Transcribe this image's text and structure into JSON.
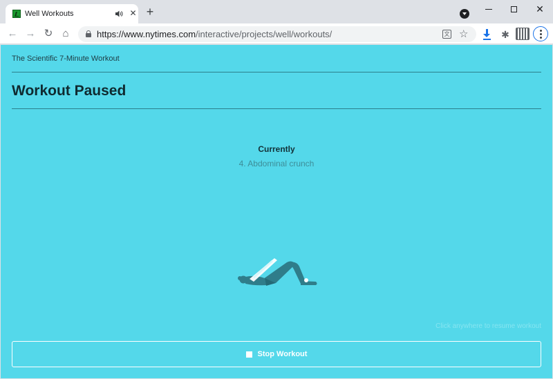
{
  "browser": {
    "tab": {
      "title": "Well Workouts"
    },
    "url": {
      "host": "https://www.nytimes.com",
      "path": "/interactive/projects/well/workouts/"
    },
    "icons": {
      "newtab": "+",
      "close": "✕",
      "window_close": "✕",
      "back": "←",
      "forward": "→",
      "reload": "↻",
      "home": "⌂",
      "star": "☆",
      "puzzle": "✱",
      "translate": "文"
    }
  },
  "page": {
    "breadcrumb": "The Scientific 7-Minute Workout",
    "title": "Workout Paused",
    "current_label": "Currently",
    "current_exercise": "4. Abdominal crunch",
    "resume_hint": "Click anywhere to resume workout",
    "stop_button_label": "Stop Workout"
  },
  "colors": {
    "page_background": "#54d8ea",
    "figure_dark": "#2f7d8a",
    "figure_light": "#ffffff"
  }
}
